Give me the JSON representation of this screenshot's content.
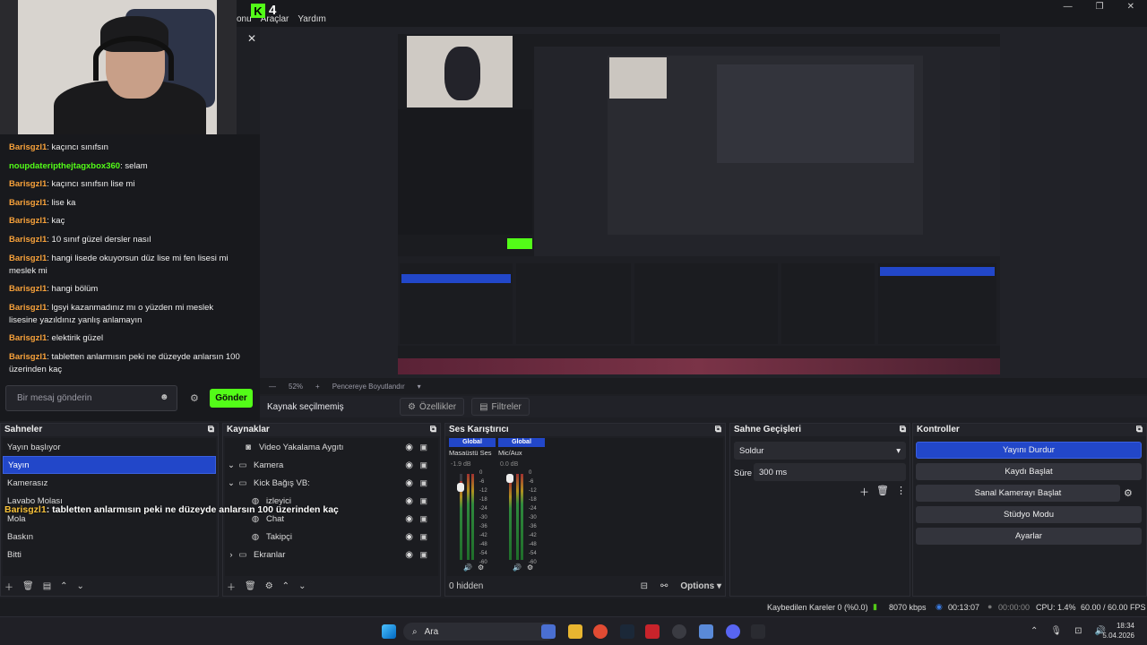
{
  "menu": {
    "items": [
      "onu",
      "Araçlar",
      "Yardım"
    ],
    "kick_count": "4"
  },
  "chat": {
    "messages": [
      {
        "user": "Barisgzl1",
        "text": "kaçıncı sınıfsın",
        "color": "#f7a13a"
      },
      {
        "user": "noupdateripthejtagxbox360",
        "text": "selam",
        "color": "#53fc18"
      },
      {
        "user": "Barisgzl1",
        "text": "kaçıncı sınıfsın lise mi",
        "color": "#f7a13a"
      },
      {
        "user": "Barisgzl1",
        "text": "lise ka",
        "color": "#f7a13a"
      },
      {
        "user": "Barisgzl1",
        "text": "kaç",
        "color": "#f7a13a"
      },
      {
        "user": "Barisgzl1",
        "text": "10 sınıf güzel dersler nasıl",
        "color": "#f7a13a"
      },
      {
        "user": "Barisgzl1",
        "text": "hangi lisede okuyorsun düz lise mi fen lisesi mi meslek mi",
        "color": "#f7a13a"
      },
      {
        "user": "Barisgzl1",
        "text": "hangi bölüm",
        "color": "#f7a13a"
      },
      {
        "user": "Barisgzl1",
        "text": "lgsyi kazanmadınız mı o yüzden mi meslek lisesine yazıldınız yanlış anlamayın",
        "color": "#f7a13a"
      },
      {
        "user": "Barisgzl1",
        "text": "elektirik güzel",
        "color": "#f7a13a"
      },
      {
        "user": "Barisgzl1",
        "text": "tabletten anlarmısın peki ne düzeyde anlarsın 100 üzerinden kaç",
        "color": "#f7a13a"
      }
    ],
    "input_placeholder": "Bir mesaj gönderin",
    "send_label": "Gönder"
  },
  "overlay": {
    "user": "Barisgzl1",
    "text": ": tabletten anlarmısın peki ne düzeyde anlarsın 100 üzerinden kaç"
  },
  "zoom": {
    "percent": "52%",
    "mode": "Pencereye Boyutlandır"
  },
  "context": {
    "label": "Kaynak seçilmemiş",
    "properties": "Özellikler",
    "filters": "Filtreler"
  },
  "scenes": {
    "title": "Sahneler",
    "items": [
      "Yayın başlıyor",
      "Yayın",
      "Kamerasız",
      "Lavabo Molası",
      "Mola",
      "Baskın",
      "Bitti"
    ],
    "selected": 1
  },
  "sources": {
    "title": "Kaynaklar",
    "items": [
      {
        "label": "Video Yakalama Aygıtı",
        "icon": "camera-icon"
      },
      {
        "label": "Kamera",
        "icon": "folder-icon"
      },
      {
        "label": "Kick Bağış VB:",
        "icon": "folder-icon"
      },
      {
        "label": "izleyici",
        "icon": "globe-icon"
      },
      {
        "label": "Chat",
        "icon": "globe-icon"
      },
      {
        "label": "Takipçi",
        "icon": "globe-icon"
      },
      {
        "label": "Ekranlar",
        "icon": "folder-icon"
      }
    ]
  },
  "mixer": {
    "title": "Ses Karıştırıcı",
    "channels": [
      {
        "tag": "Global",
        "name": "Masaüstü Ses",
        "db": "-1.9 dB"
      },
      {
        "tag": "Global",
        "name": "Mic/Aux",
        "db": "0.0 dB"
      }
    ],
    "scale": [
      "0",
      "-6",
      "-12",
      "-18",
      "-24",
      "-30",
      "-36",
      "-42",
      "-48",
      "-54",
      "-60"
    ],
    "hidden": "0 hidden",
    "options": "Options"
  },
  "transitions": {
    "title": "Sahne Geçişleri",
    "type": "Soldur",
    "duration_label": "Süre",
    "duration": "300 ms"
  },
  "controls": {
    "title": "Kontroller",
    "buttons": [
      "Yayını Durdur",
      "Kaydı Başlat",
      "Sanal Kamerayı Başlat",
      "Stüdyo Modu",
      "Ayarlar"
    ]
  },
  "status": {
    "dropped": "Kaybedilen Kareler 0 (%0.0)",
    "bitrate": "8070 kbps",
    "stream_time": "00:13:07",
    "rec_time": "00:00:00",
    "cpu": "CPU: 1.4%",
    "fps": "60.00 / 60.00 FPS"
  },
  "taskbar": {
    "search": "Ara",
    "time": "18:34",
    "date": "5.04.2026"
  },
  "colors": {
    "accent": "#2247c9",
    "kick_green": "#53fc18",
    "username": "#f7a13a"
  }
}
